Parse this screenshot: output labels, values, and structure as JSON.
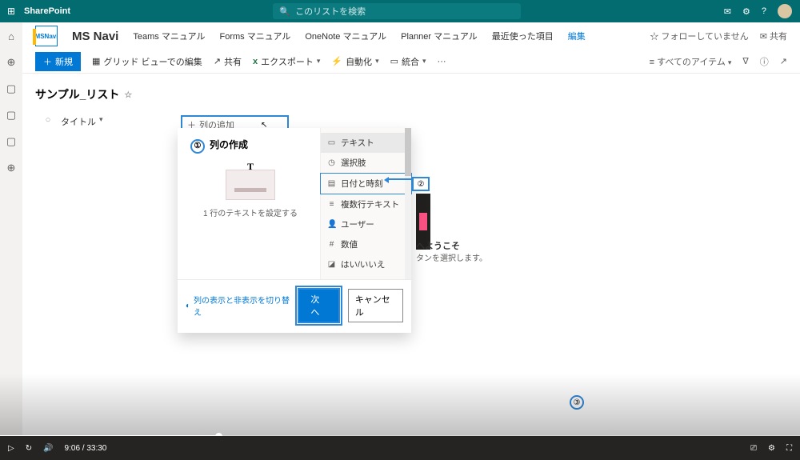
{
  "suite": {
    "app": "SharePoint",
    "search_ph": "このリストを検索"
  },
  "rail": {
    "icons": [
      "⌂",
      "⊕",
      "▭",
      "▭",
      "▭",
      "⊕"
    ]
  },
  "site": {
    "logo": "MSNavi",
    "name": "MS Navi",
    "nav": [
      "Teams マニュアル",
      "Forms マニュアル",
      "OneNote マニュアル",
      "Planner マニュアル",
      "最近使った項目"
    ],
    "edit": "編集",
    "follow": "☆ フォローしていません",
    "share": "共有"
  },
  "cmd": {
    "new": "新規",
    "grid": "グリッド ビューでの編集",
    "share": "共有",
    "export": "エクスポート",
    "automate": "自動化",
    "integrate": "統合",
    "filter": "すべてのアイテム"
  },
  "list": {
    "title": "サンプル_リスト",
    "col_title": "タイトル",
    "add": "列の追加"
  },
  "panel": {
    "heading": "列の作成",
    "desc": "1 行のテキストを設定する",
    "types": [
      "テキスト",
      "選択肢",
      "日付と時刻",
      "複数行テキスト",
      "ユーザー",
      "数値",
      "はい/いいえ"
    ],
    "toggle": "列の表示と非表示を切り替え",
    "next": "次へ",
    "cancel": "キャンセル"
  },
  "markers": {
    "m1": "①",
    "m2": "②",
    "m3": "③"
  },
  "bg": {
    "welcome_a": "へようこそ",
    "welcome_b": "タンを選択します。"
  },
  "player": {
    "time": "9:06 / 33:30"
  }
}
